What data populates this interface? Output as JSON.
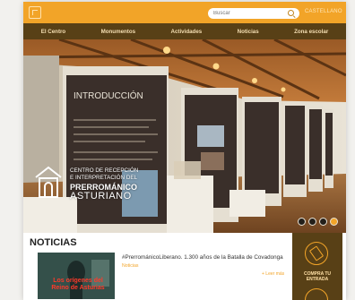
{
  "colors": {
    "accent": "#f2a428",
    "nav_bg": "#584016",
    "news_category": "#f2a428"
  },
  "header": {
    "search_placeholder": "Buscar",
    "top_link": "CASTELLANO"
  },
  "nav": {
    "items": [
      "El Centro",
      "Monumentos",
      "Actividades",
      "Noticias",
      "Zona escolar"
    ]
  },
  "hero": {
    "panel_title": "INTRODUCCIÓN",
    "brand": {
      "line1": "CENTRO DE RECEPCIÓN",
      "line2": "E INTERPRETACIÓN DEL",
      "line3": "PRERROMÁNICO",
      "line4": "ASTURIANO"
    },
    "slider_dots": 4,
    "active_dot": 3
  },
  "news": {
    "section_title": "NOTICIAS",
    "thumb_text": "Los orígenes del Reino de Asturias",
    "headline": "#PrerrománicoLiberano. 1.300 años de la Batalla de Covadonga",
    "category": "Noticias",
    "more_link": "+ Leer más"
  },
  "side": {
    "ticket_label_line1": "COMPRA TU",
    "ticket_label_line2": "ENTRADA"
  }
}
